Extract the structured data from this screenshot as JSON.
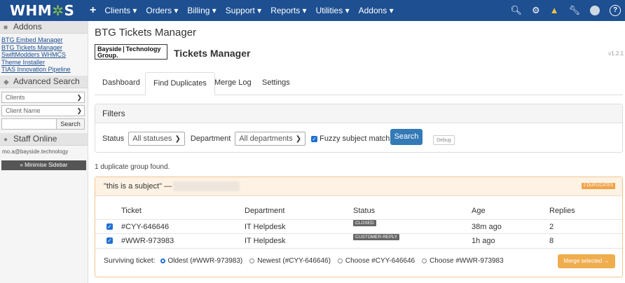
{
  "topbar": {
    "logo_prefix": "WHM",
    "logo_cog": "✲",
    "logo_suffix": "S",
    "plus": "+",
    "nav": [
      "Clients ▾",
      "Orders ▾",
      "Billing ▾",
      "Support ▾",
      "Reports ▾",
      "Utilities ▾",
      "Addons ▾"
    ],
    "icons": [
      "search-icon",
      "cog-icon",
      "alert-icon",
      "wrench-icon",
      "user-avatar-icon",
      "help-icon"
    ],
    "accent": "#1d4f91"
  },
  "sidebar": {
    "addons_title": "Addons",
    "addon_links": [
      "BTG Embed Manager",
      "BTG Tickets Manager",
      "SwiftModders WHMCS Theme Installer",
      "TIAS Innovation Pipeline"
    ],
    "advanced_search_title": "Advanced Search",
    "select_clients": "Clients",
    "select_client_name": "Client Name",
    "search_button": "Search",
    "staff_online_title": "Staff Online",
    "staff_email": "mo.a@bayside.technology",
    "minimise_label": "« Minimise Sidebar"
  },
  "main": {
    "page_title": "BTG Tickets Manager",
    "logo_line1": "Bayside",
    "logo_line1b": "Technology",
    "logo_line2": "Group.",
    "module_title": "Tickets Manager",
    "version": "v1.2.1",
    "tabs": [
      "Dashboard",
      "Find Duplicates",
      "Merge Log",
      "Settings"
    ],
    "active_tab": "Find Duplicates"
  },
  "filters": {
    "title": "Filters",
    "status_label": "Status",
    "status_value": "All statuses",
    "department_label": "Department",
    "department_value": "All departments",
    "fuzzy_label": "Fuzzy subject matching",
    "fuzzy_checked": true,
    "search_button": "Search",
    "debug_button": "Debug"
  },
  "results": {
    "summary": "1 duplicate group found.",
    "group": {
      "subject": "\"this is a subject\"  —",
      "badge": "2 DUPLICATES",
      "columns": [
        "Ticket",
        "Department",
        "Status",
        "Age",
        "Replies"
      ],
      "rows": [
        {
          "ticket": "#CYY-646646",
          "department": "IT Helpdesk",
          "status": "CLOSED",
          "age": "38m ago",
          "replies": "2",
          "checked": true
        },
        {
          "ticket": "#WWR-973983",
          "department": "IT Helpdesk",
          "status": "CUSTOMER-REPLY",
          "age": "1h ago",
          "replies": "8",
          "checked": true
        }
      ],
      "surviving_label": "Surviving ticket:",
      "options": [
        "Oldest (#WWR-973983)",
        "Newest (#CYY-646646)",
        "Choose #CYY-646646",
        "Choose #WWR-973983"
      ],
      "selected_option": "Oldest (#WWR-973983)",
      "merge_button": "Merge selected →"
    }
  }
}
